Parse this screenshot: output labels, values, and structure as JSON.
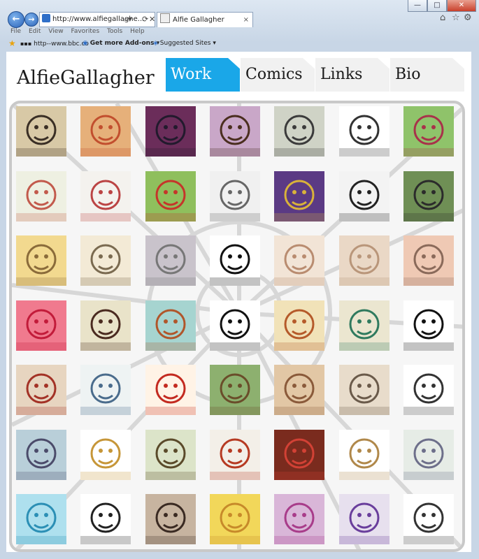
{
  "browser": {
    "address": "http://www.alfiegallaghe...",
    "tab_title": "Alfie Gallagher",
    "tab_close": "×",
    "menu": [
      "File",
      "Edit",
      "View",
      "Favorites",
      "Tools",
      "Help"
    ],
    "favorites": {
      "site1": "http--www.bbc.co",
      "addons": "Get more Add-ons ▾",
      "suggested": "Suggested Sites ▾"
    },
    "window_controls": [
      "—",
      "□",
      "✕"
    ]
  },
  "site": {
    "logo": "AlfieGallagher",
    "tabs": [
      "Work",
      "Comics",
      "Links",
      "Bio"
    ],
    "active_tab": "Work"
  },
  "tiles": [
    [
      "#d8c9a6",
      "#3a2f25",
      "chaplin-portrait"
    ],
    [
      "#e6b07a",
      "#c24f2e",
      "woman-red-hair"
    ],
    [
      "#6b2d5a",
      "#221a2d",
      "man-in-hat"
    ],
    [
      "#c9a7c8",
      "#4a2e1f",
      "mustache-man"
    ],
    [
      "#cfd3c6",
      "#3b3b3b",
      "bearded-mask"
    ],
    [
      "#ffffff",
      "#333333",
      "hand-sketch"
    ],
    [
      "#8fc36a",
      "#a8324a",
      "goblin"
    ],
    [
      "#eef0e2",
      "#c25a4c",
      "red-creature"
    ],
    [
      "#f4f2ee",
      "#b44",
      "blue-skirt"
    ],
    [
      "#8fbf5d",
      "#c5352a",
      "guitar"
    ],
    [
      "#f0f0f0",
      "#666",
      "pixel-face"
    ],
    [
      "#5b3a84",
      "#d9b23a",
      "purple-ornament"
    ],
    [
      "#f3f3f3",
      "#222",
      "skeleton"
    ],
    [
      "#6f8f55",
      "#2b2b2b",
      "green-zombie"
    ],
    [
      "#f2d98f",
      "#8a6b3a",
      "zeppelin"
    ],
    [
      "#f3ead6",
      "#7a6a50",
      "baby-sketch"
    ],
    [
      "#c9c3cb",
      "#777",
      "rain-cloud"
    ],
    [
      "#ffffff",
      "#111",
      "figure-silhouette"
    ],
    [
      "#f2e4d6",
      "#b98c70",
      "legs"
    ],
    [
      "#ead8c6",
      "#b9967a",
      "taj-mahal"
    ],
    [
      "#efc9b4",
      "#8a6a5a",
      "girl-glasses"
    ],
    [
      "#f07a8e",
      "#c21b3a",
      "gift-box"
    ],
    [
      "#e9e3c9",
      "#4a2a20",
      "mouth-teeth"
    ],
    [
      "#a6d4d0",
      "#b0562b",
      "lion"
    ],
    [
      "#ffffff",
      "#111",
      "woman-lips"
    ],
    [
      "#f1e2b8",
      "#b55a2a",
      "fox"
    ],
    [
      "#ebe6d0",
      "#2f7a5e",
      "initials-c"
    ],
    [
      "#ffffff",
      "#111",
      "fish-pattern"
    ],
    [
      "#e7d5c0",
      "#a33226",
      "tiger"
    ],
    [
      "#eef3f3",
      "#4a6c8c",
      "blue-bug"
    ],
    [
      "#fff3e6",
      "#c32a20",
      "cartoon-duck"
    ],
    [
      "#8db06f",
      "#6a4d2a",
      "ninja-turtle"
    ],
    [
      "#e2c7a5",
      "#8a5a3a",
      "boy-face"
    ],
    [
      "#e8dccb",
      "#6a5a4a",
      "bearded-man"
    ],
    [
      "#ffffff",
      "#333",
      "woman-portrait"
    ],
    [
      "#b9cfd9",
      "#4b4b6a",
      "old-man"
    ],
    [
      "#ffffff",
      "#c69638",
      "hat-pour"
    ],
    [
      "#dce4c9",
      "#5a4a2a",
      "gramophone"
    ],
    [
      "#f3efe8",
      "#b63a22",
      "red-hair-girl"
    ],
    [
      "#7a2b1e",
      "#d24135",
      "roses"
    ],
    [
      "#ffffff",
      "#b0884a",
      "dancer"
    ],
    [
      "#e6ece6",
      "#6d6f8a",
      "eiffel-tower"
    ],
    [
      "#aee0ee",
      "#2b8fb5",
      "blue-elephant"
    ],
    [
      "#ffffff",
      "#222",
      "cartoon-kid"
    ],
    [
      "#c7b4a0",
      "#3a2a22",
      "bear-eyepatch"
    ],
    [
      "#f2d75a",
      "#c78a2a",
      "yellow-duck"
    ],
    [
      "#d9b6d8",
      "#a83c8a",
      "ballerina"
    ],
    [
      "#e7e0ee",
      "#6a3e9c",
      "initials-jb"
    ],
    [
      "#ffffff",
      "#333",
      "girl-sketch"
    ]
  ]
}
